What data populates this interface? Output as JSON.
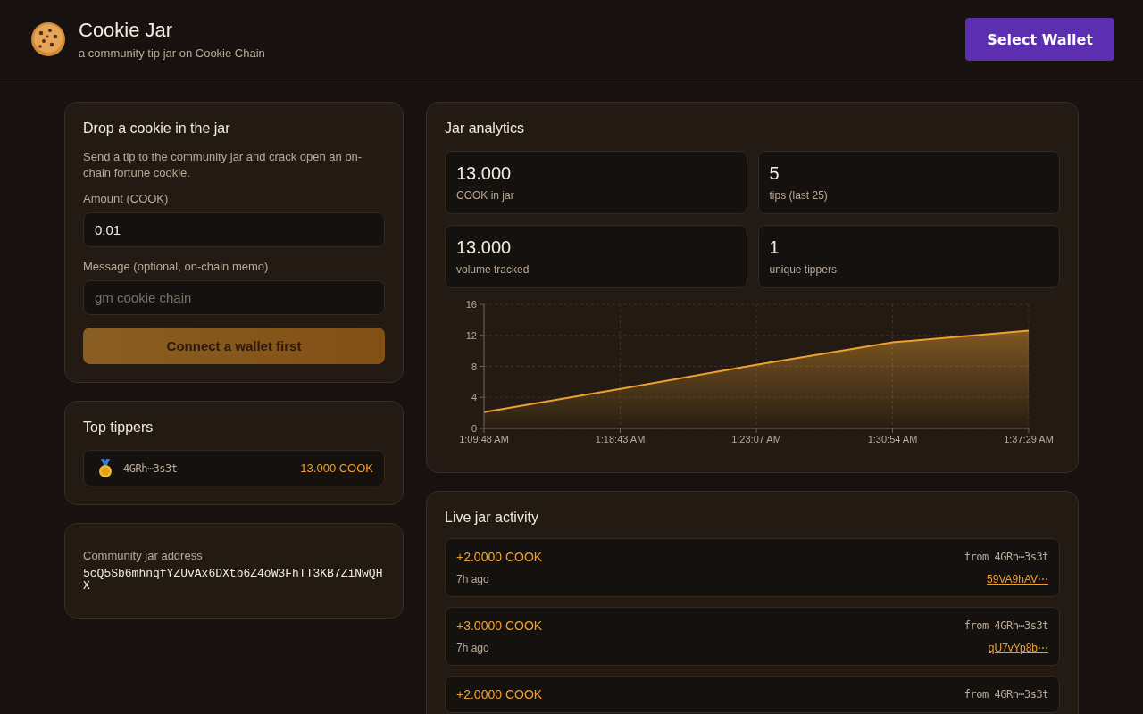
{
  "header": {
    "title": "Cookie Jar",
    "subtitle": "a community tip jar on Cookie Chain",
    "wallet_button": "Select Wallet"
  },
  "tip_form": {
    "title": "Drop a cookie in the jar",
    "description": "Send a tip to the community jar and crack open an on-chain fortune cookie.",
    "amount_label": "Amount (COOK)",
    "amount_value": "0.01",
    "message_label": "Message (optional, on-chain memo)",
    "message_placeholder": "gm cookie chain",
    "submit_button": "Connect a wallet first",
    "submit_disabled": true
  },
  "top_tippers": {
    "title": "Top tippers",
    "rows": [
      {
        "address": "4GRh⋯3s3t",
        "total": "13.000 COOK"
      }
    ]
  },
  "jar_address": {
    "label": "Community jar address",
    "value": "5cQ5Sb6mhnqfYZUvAx6DXtb6Z4oW3FhTT3KB7ZiNwQHX"
  },
  "analytics": {
    "title": "Jar analytics",
    "stats": [
      {
        "value": "13.000",
        "label": "COOK in jar"
      },
      {
        "value": "5",
        "label": "tips (last 25)"
      },
      {
        "value": "13.000",
        "label": "volume tracked"
      },
      {
        "value": "1",
        "label": "unique tippers"
      }
    ],
    "chart_data": {
      "type": "area",
      "categories": [
        "1:09:48 AM",
        "1:18:43 AM",
        "1:23:07 AM",
        "1:30:54 AM",
        "1:37:29 AM"
      ],
      "series": [
        {
          "color": "#f0a030",
          "values": [
            2.1,
            5.1,
            8.2,
            11.1,
            12.6
          ]
        }
      ],
      "grid": true,
      "ylim": [
        0,
        16
      ],
      "yticks": [
        0,
        4,
        8,
        12,
        16
      ]
    }
  },
  "activity": {
    "title": "Live jar activity",
    "items": [
      {
        "amount": "+2.0000 COOK",
        "from": "from 4GRh⋯3s3t",
        "time": "7h ago",
        "tx": "59VA9hAV⋯"
      },
      {
        "amount": "+3.0000 COOK",
        "from": "from 4GRh⋯3s3t",
        "time": "7h ago",
        "tx": "qU7vYp8b⋯"
      },
      {
        "amount": "+2.0000 COOK",
        "from": "from 4GRh⋯3s3t"
      }
    ]
  }
}
